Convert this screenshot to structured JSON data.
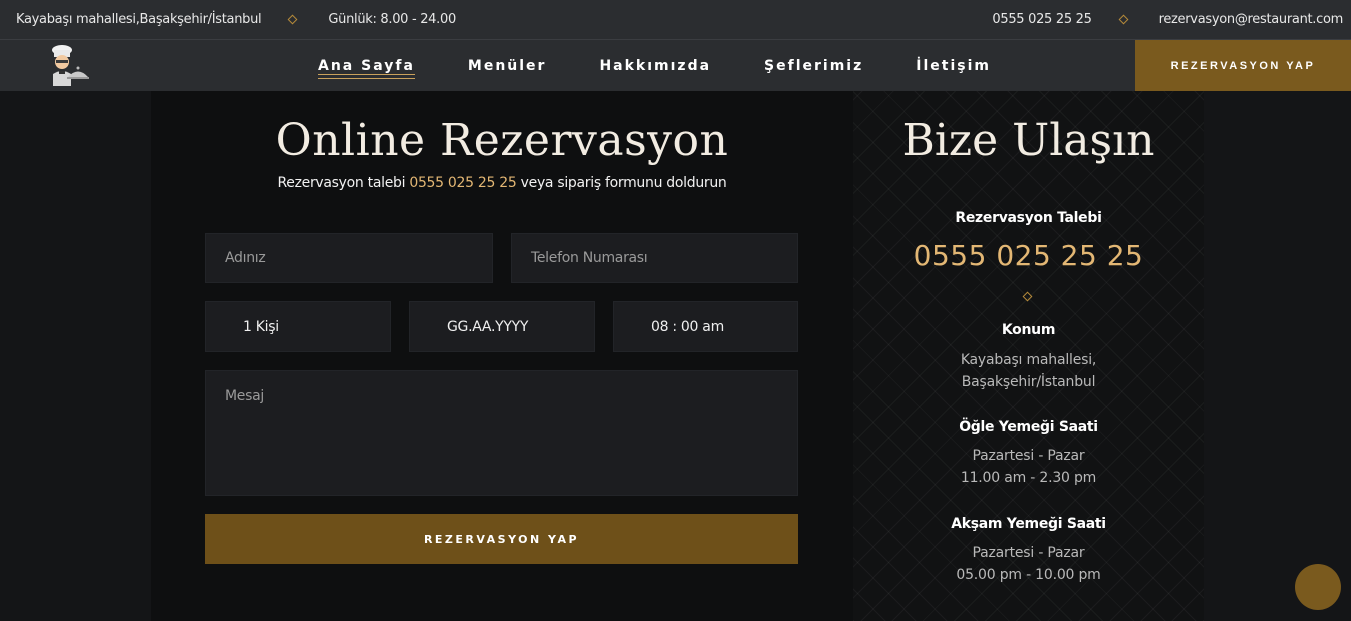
{
  "topbar": {
    "address": "Kayabaşı mahallesi,Başakşehir/İstanbul",
    "hours": "Günlük: 8.00 - 24.00",
    "phone": "0555 025 25 25",
    "email": "rezervasyon@restaurant.com"
  },
  "nav": {
    "logo_icon": "chef-logo-icon",
    "items": [
      "Ana Sayfa",
      "Menüler",
      "Hakkımızda",
      "Şeflerimiz",
      "İletişim"
    ],
    "active_index": 0,
    "cta": "REZERVASYON YAP"
  },
  "reservation": {
    "title": "Online Rezervasyon",
    "subtitle_prefix": "Rezervasyon talebi",
    "subtitle_phone": "0555 025 25 25",
    "subtitle_suffix": "veya sipariş formunu doldurun",
    "name_placeholder": "Adınız",
    "phone_placeholder": "Telefon Numarası",
    "people_value": "1 Kişi",
    "date_value": "GG.AA.YYYY",
    "time_value": "08 : 00 am",
    "message_placeholder": "Mesaj",
    "submit": "REZERVASYON YAP"
  },
  "contact": {
    "title": "Bize Ulaşın",
    "request_label": "Rezervasyon Talebi",
    "request_phone": "0555 025 25 25",
    "location_label": "Konum",
    "location_line1": "Kayabaşı mahallesi,",
    "location_line2": "Başakşehir/İstanbul",
    "lunch_label": "Öğle Yemeği Saati",
    "lunch_days": "Pazartesi - Pazar",
    "lunch_hours": "11.00 am - 2.30 pm",
    "dinner_label": "Akşam Yemeği Saati",
    "dinner_days": "Pazartesi - Pazar",
    "dinner_hours": "05.00 pm - 10.00 pm"
  },
  "colors": {
    "accent": "#7a5a1e",
    "gold_text": "#e3b774",
    "background": "#141517"
  }
}
